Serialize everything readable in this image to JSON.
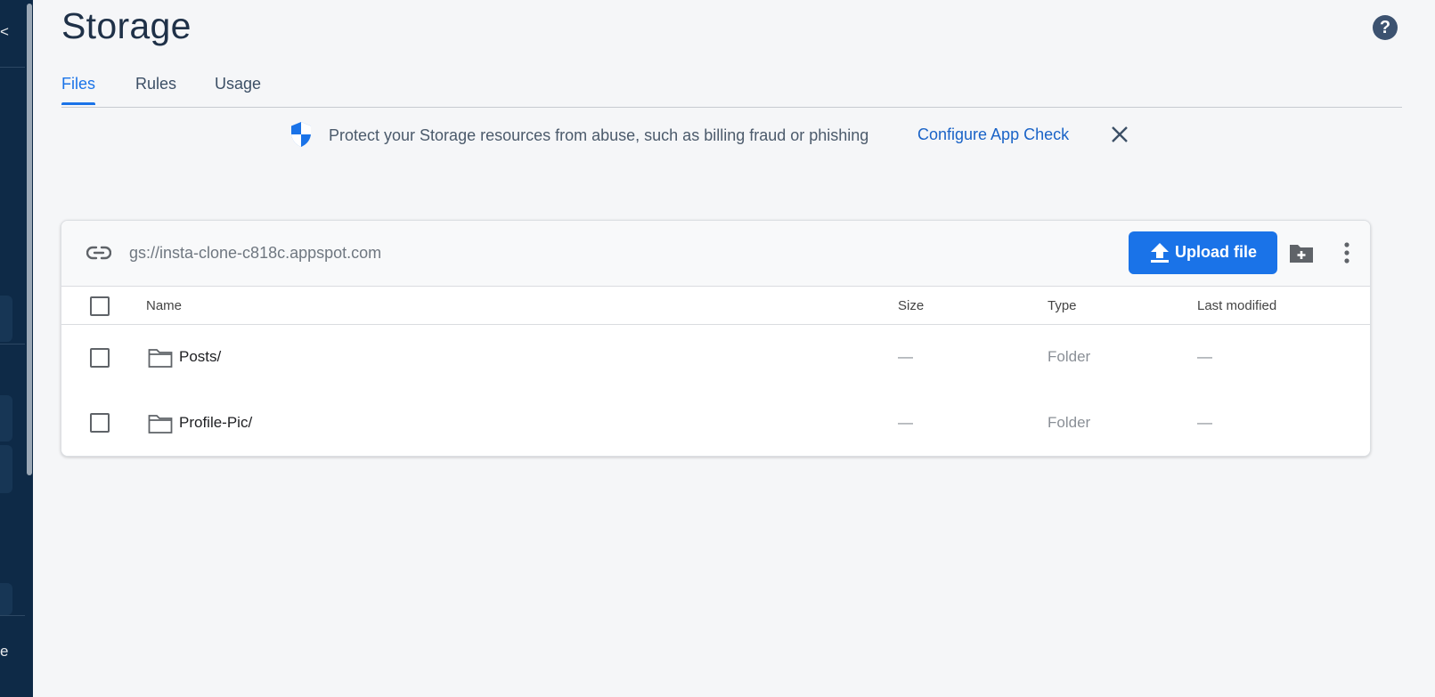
{
  "page": {
    "title": "Storage"
  },
  "tabs": [
    {
      "label": "Files",
      "active": true
    },
    {
      "label": "Rules",
      "active": false
    },
    {
      "label": "Usage",
      "active": false
    }
  ],
  "banner": {
    "icon": "shield-icon",
    "text": "Protect your Storage resources from abuse, such as billing fraud or phishing",
    "link": "Configure App Check"
  },
  "toolbar": {
    "bucket": "gs://insta-clone-c818c.appspot.com",
    "upload_label": "Upload file"
  },
  "table": {
    "headers": {
      "name": "Name",
      "size": "Size",
      "type": "Type",
      "modified": "Last modified"
    },
    "rows": [
      {
        "name": "Posts/",
        "size": "—",
        "type": "Folder",
        "modified": "—"
      },
      {
        "name": "Profile-Pic/",
        "size": "—",
        "type": "Folder",
        "modified": "—"
      }
    ]
  },
  "sidebar": {
    "partial_labels": [
      "<",
      "e"
    ]
  },
  "colors": {
    "accent": "#1a73e8",
    "sidebar": "#0e2a47",
    "title": "#1f3148"
  }
}
